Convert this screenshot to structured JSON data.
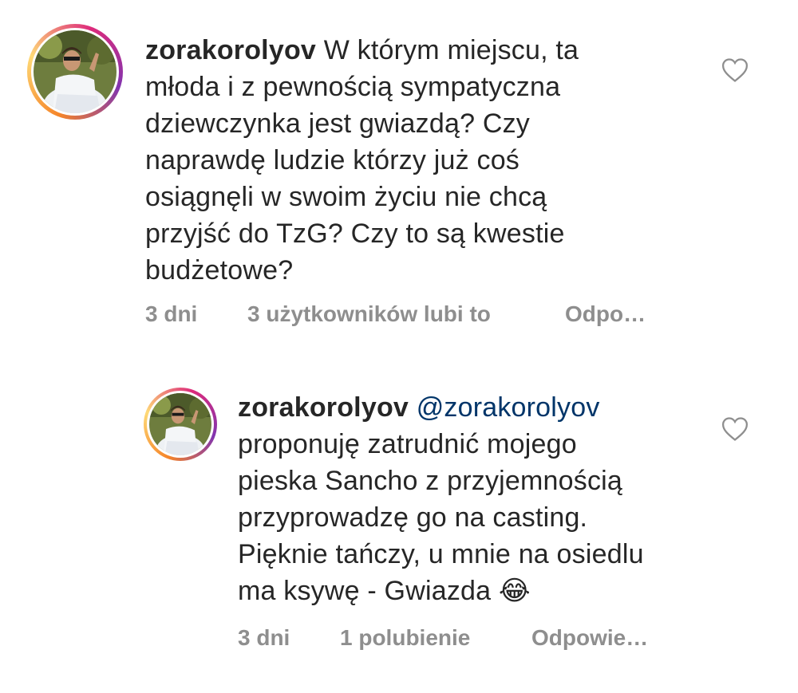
{
  "comments": [
    {
      "username": "zorakorolyov",
      "lines": [
        "W którym miejscu, ta",
        "młoda i z pewnością sympatyczna",
        "dziewczynka jest gwiazdą? Czy",
        "naprawdę ludzie którzy już coś",
        "osiągnęli w swoim życiu nie chcą",
        "przyjść do TzG? Czy to są kwestie",
        "budżetowe?"
      ],
      "time": "3 dni",
      "likes": "3 użytkowników lubi to",
      "reply": "Odpo…"
    },
    {
      "username": "zorakorolyov",
      "mention": "@zorakorolyov",
      "lines": [
        "proponuję zatrudnić mojego",
        "pieska Sancho z przyjemnością",
        "przyprowadzę go na casting.",
        "Pięknie tańczy, u mnie na osiedlu",
        "ma ksywę - Gwiazda 😂"
      ],
      "time": "3 dni",
      "likes": "1 polubienie",
      "reply": "Odpowie…"
    }
  ],
  "icons": {
    "like": "heart-outline-icon"
  },
  "colors": {
    "text": "#262626",
    "meta": "#8e8e8e",
    "mention": "#003569"
  }
}
